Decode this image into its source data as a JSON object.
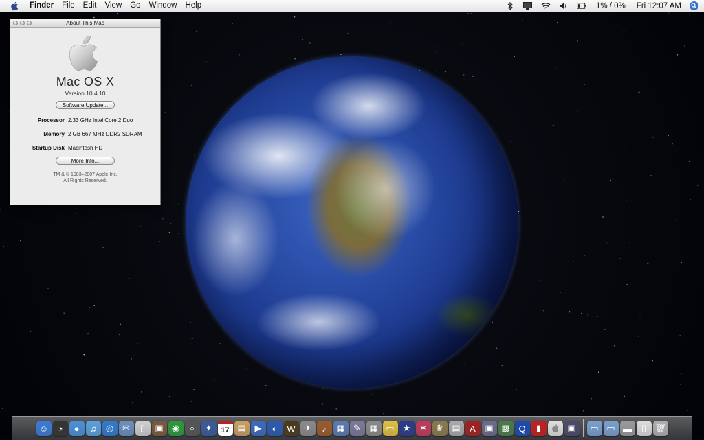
{
  "menubar": {
    "app_name": "Finder",
    "menus": [
      "File",
      "Edit",
      "View",
      "Go",
      "Window",
      "Help"
    ],
    "battery_text": "1% / 0%",
    "clock": "Fri 12:07 AM",
    "status_icons": [
      "bluetooth-icon",
      "display-icon",
      "wifi-icon",
      "volume-icon",
      "battery-icon"
    ]
  },
  "about_window": {
    "title": "About This Mac",
    "os_name": "Mac OS X",
    "version": "Version 10.4.10",
    "software_update_label": "Software Update...",
    "processor_label": "Processor",
    "processor_value": "2.33 GHz Intel Core 2 Duo",
    "memory_label": "Memory",
    "memory_value": "2 GB 667 MHz DDR2 SDRAM",
    "startup_disk_label": "Startup Disk",
    "startup_disk_value": "Macintosh HD",
    "more_info_label": "More Info...",
    "copyright_line1": "TM & © 1983–2007 Apple Inc.",
    "copyright_line2": "All Rights Reserved."
  },
  "dock": {
    "calendar_day": "17",
    "apps": [
      {
        "name": "finder-icon",
        "color": "#3a7bd5",
        "glyph": "☺"
      },
      {
        "name": "dashboard-icon",
        "color": "#333333",
        "glyph": "◔"
      },
      {
        "name": "ichat-icon",
        "color": "#4a90d9",
        "glyph": "●"
      },
      {
        "name": "itunes-icon",
        "color": "#5aa0e0",
        "glyph": "♫"
      },
      {
        "name": "safari-icon",
        "color": "#2f7ad0",
        "glyph": "◎"
      },
      {
        "name": "mail-icon",
        "color": "#6a8fc0",
        "glyph": "✉"
      },
      {
        "name": "ipod-icon",
        "color": "#d0d0d0",
        "glyph": "▯"
      },
      {
        "name": "iphoto-icon",
        "color": "#7a5a3a",
        "glyph": "▣"
      },
      {
        "name": "time-machine-icon",
        "color": "#2a9a3a",
        "glyph": "◉"
      },
      {
        "name": "preview-icon",
        "color": "#555555",
        "glyph": "⌕"
      },
      {
        "name": "system-icon",
        "color": "#3a5a9a",
        "glyph": "✦"
      },
      {
        "name": "ical-icon",
        "color": "#ffffff",
        "glyph": ""
      },
      {
        "name": "notes-icon",
        "color": "#c8a060",
        "glyph": "▤"
      },
      {
        "name": "imovie-icon",
        "color": "#3a6ac0",
        "glyph": "▶"
      },
      {
        "name": "dvd-player-icon",
        "color": "#2a5ab0",
        "glyph": "◐"
      },
      {
        "name": "warcraft-icon",
        "color": "#4a3a1a",
        "glyph": "W"
      },
      {
        "name": "telescope-icon",
        "color": "#8a8a8a",
        "glyph": "✈"
      },
      {
        "name": "guitar-icon",
        "color": "#9a5a2a",
        "glyph": "♪"
      },
      {
        "name": "network-icon",
        "color": "#5a7ab0",
        "glyph": "▦"
      },
      {
        "name": "script-icon",
        "color": "#7a7a9a",
        "glyph": "✎"
      },
      {
        "name": "calculator-icon",
        "color": "#8a8a8a",
        "glyph": "▦"
      },
      {
        "name": "stickies-icon",
        "color": "#e0c040",
        "glyph": "▭"
      },
      {
        "name": "wizard-icon",
        "color": "#2a3a8a",
        "glyph": "★"
      },
      {
        "name": "comic-icon",
        "color": "#c03a5a",
        "glyph": "✶"
      },
      {
        "name": "game-icon",
        "color": "#8a7a4a",
        "glyph": "♛"
      },
      {
        "name": "printer-icon",
        "color": "#aaaaaa",
        "glyph": "▤"
      },
      {
        "name": "dictionary-icon",
        "color": "#a02020",
        "glyph": "A"
      },
      {
        "name": "photo-icon",
        "color": "#6a6a8a",
        "glyph": "▣"
      },
      {
        "name": "slideshow-icon",
        "color": "#4a7a4a",
        "glyph": "▩"
      },
      {
        "name": "quicktime-icon",
        "color": "#1a4ab0",
        "glyph": "Q"
      },
      {
        "name": "red-app-icon",
        "color": "#c02020",
        "glyph": "▮"
      },
      {
        "name": "apple-icon",
        "color": "#e0e0e0",
        "glyph": ""
      },
      {
        "name": "photo-booth-icon",
        "color": "#4a4a6a",
        "glyph": "▣"
      }
    ],
    "folders": [
      {
        "name": "applications-folder-icon",
        "color": "#7aa0d0",
        "glyph": "▭"
      },
      {
        "name": "documents-folder-icon",
        "color": "#7aa0d0",
        "glyph": "▭"
      },
      {
        "name": "drive-icon",
        "color": "#9a9a9a",
        "glyph": "▬"
      },
      {
        "name": "file-icon",
        "color": "#dddddd",
        "glyph": "▯"
      },
      {
        "name": "trash-icon",
        "color": "#b0b0b0",
        "glyph": "🗑"
      }
    ]
  }
}
